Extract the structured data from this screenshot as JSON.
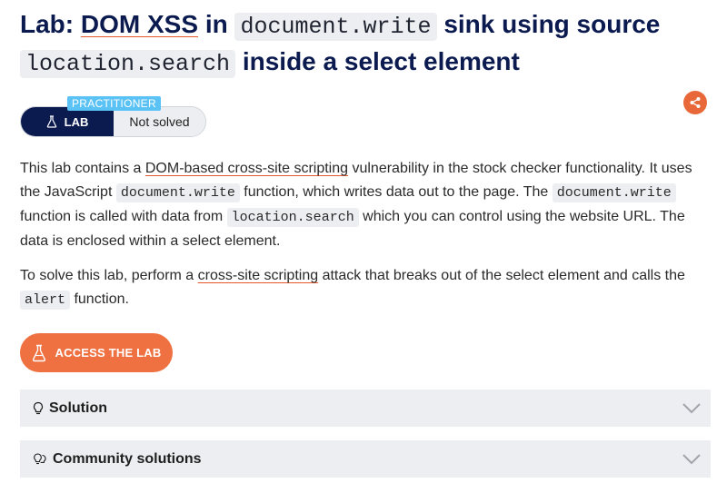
{
  "title": {
    "prefix": "Lab:",
    "linked": "DOM XSS",
    "in": "in",
    "code1": "document.write",
    "middle": "sink using source",
    "code2": "location.search",
    "suffix": "inside a select element"
  },
  "level": {
    "tag": "PRACTITIONER",
    "lab_label": "LAB",
    "status": "Not solved"
  },
  "description": {
    "p1_a": "This lab contains a ",
    "p1_link": "DOM-based cross-site scripting",
    "p1_b": " vulnerability in the stock checker functionality. It uses the JavaScript ",
    "p1_code1": "document.write",
    "p1_c": " function, which writes data out to the page. The ",
    "p1_code2": "document.write",
    "p1_d": " function is called with data from ",
    "p1_code3": "location.search",
    "p1_e": " which you can control using the website URL. The data is enclosed within a select element.",
    "p2_a": "To solve this lab, perform a ",
    "p2_link": "cross-site scripting",
    "p2_b": " attack that breaks out of the select element and calls the ",
    "p2_code": "alert",
    "p2_c": " function."
  },
  "access_button": "ACCESS THE LAB",
  "accordions": [
    {
      "label": "Solution",
      "icon": "lightbulb-icon"
    },
    {
      "label": "Community solutions",
      "icon": "lightbulbs-icon"
    }
  ],
  "colors": {
    "navy": "#0b1a4f",
    "orange": "#ef7040",
    "badge": "#5bc2f5",
    "panel": "#eceef1"
  }
}
